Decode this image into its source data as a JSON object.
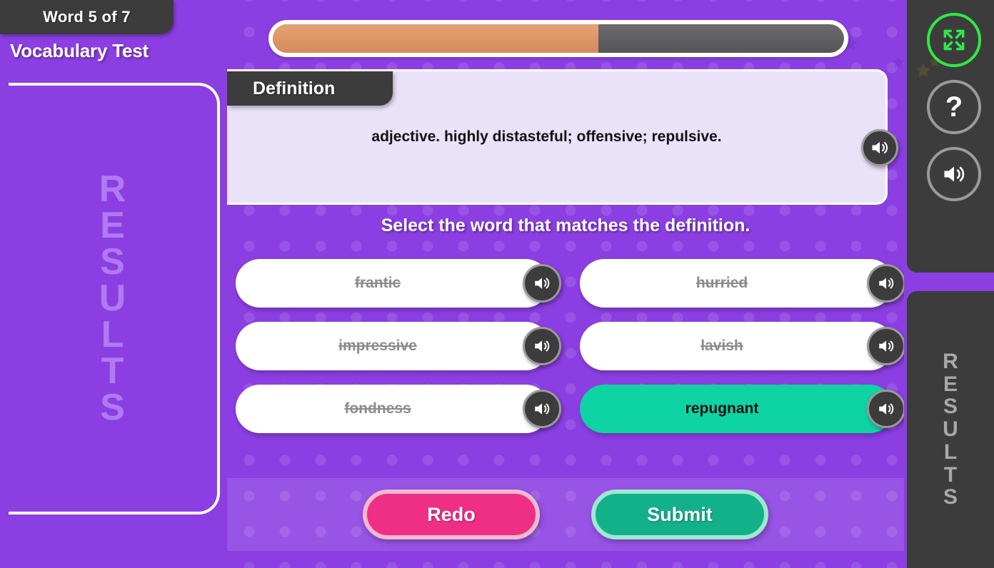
{
  "header": {
    "word_counter": "Word 5 of 7",
    "app_title": "Vocabulary Test"
  },
  "progress": {
    "percent": 57,
    "current": 5,
    "total": 7,
    "fill_color": "#d58a5c",
    "track_color": "#5d5d60"
  },
  "definition": {
    "tab_label": "Definition",
    "text": "adjective. highly distasteful; offensive; repulsive.",
    "speaker_icon": "speaker-icon"
  },
  "prompt": "Select the word that matches the definition.",
  "options": [
    {
      "label": "frantic",
      "state": "eliminated",
      "speaker_icon": "speaker-icon"
    },
    {
      "label": "hurried",
      "state": "eliminated",
      "speaker_icon": "speaker-icon"
    },
    {
      "label": "impressive",
      "state": "eliminated",
      "speaker_icon": "speaker-icon"
    },
    {
      "label": "lavish",
      "state": "eliminated",
      "speaker_icon": "speaker-icon"
    },
    {
      "label": "fondness",
      "state": "eliminated",
      "speaker_icon": "speaker-icon"
    },
    {
      "label": "repugnant",
      "state": "selected",
      "speaker_icon": "speaker-icon"
    }
  ],
  "actions": {
    "redo_label": "Redo",
    "submit_label": "Submit",
    "redo_color": "#ef2f85",
    "submit_color": "#13b189"
  },
  "left_panel": {
    "label_letters": [
      "R",
      "E",
      "S",
      "U",
      "L",
      "T",
      "S"
    ],
    "text_color": "#b07af0"
  },
  "right_panel": {
    "label_letters": [
      "R",
      "E",
      "S",
      "U",
      "L",
      "T",
      "S"
    ],
    "text_color": "#a8a8a8"
  },
  "rail_buttons": [
    {
      "icon": "fullscreen-icon",
      "label": "",
      "accent": "#2ee84a"
    },
    {
      "icon": "help-icon",
      "label": "?",
      "accent": "#9a9a9a"
    },
    {
      "icon": "speaker-icon",
      "label": "",
      "accent": "#9a9a9a"
    }
  ],
  "theme": {
    "background": "#8b3fe2",
    "panel_dark": "#3c3c3c",
    "definition_bg": "#e9e2f8",
    "selected_option": "#0ed3a3"
  }
}
